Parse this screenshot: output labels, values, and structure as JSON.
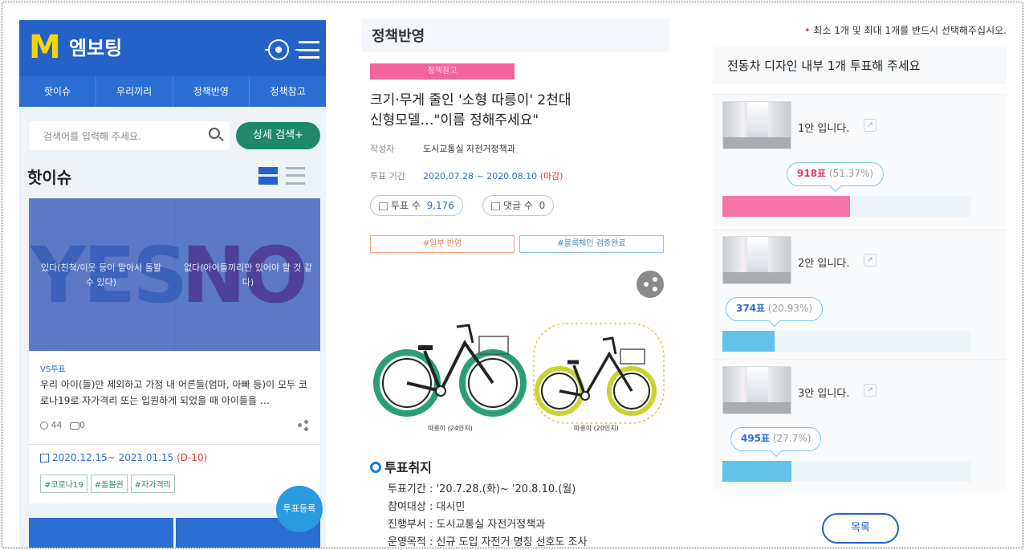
{
  "app": {
    "logo_letter": "M",
    "logo_text": "엠보팅"
  },
  "nav": {
    "tabs": [
      "핫이슈",
      "우리끼리",
      "정책반영",
      "정책참고"
    ]
  },
  "search": {
    "placeholder": "검색어를 입력해 주세요.",
    "detail_button": "상세 검색+"
  },
  "hot_issue": {
    "title": "핫이슈",
    "card": {
      "yes_word": "YES",
      "no_word": "NO",
      "yes_text": "있다(친척/이웃 등이 맡아서 돌봘 수 있다)",
      "no_text": "없다(아이들끼리만 있어야 할 것 같다)",
      "type": "VS투표",
      "desc": "우리 아이(들)만 제외하고 가정 내 어른들(엄마, 아빠 등)이 모두 코로나19로 자가격리 또는 입원하게 되었을 때 아이들을 …",
      "participants": "44",
      "comments": "0",
      "date": "2020.12.15~ 2021.01.15",
      "dday": "(D-10)",
      "tags": [
        "#코로나19",
        "#돌봄권",
        "#자가격리"
      ]
    },
    "fab": "투표등록"
  },
  "policy": {
    "header": "정책반영",
    "badge": "정책참고",
    "headline_line1": "크기·무게 줄인 '소형 따릉이' 2천대",
    "headline_line2": "신형모델…\"이름 정해주세요\"",
    "author_label": "작성자",
    "author": "도시교통실 자전거정책과",
    "period_label": "투표 기간",
    "period": "2020.07.28 ~ 2020.08.10",
    "period_status": "(마감)",
    "votes_label": "투표 수",
    "votes": "9,176",
    "comments_label": "댓글 수",
    "comments": "0",
    "status_partial": "#일부 반영",
    "status_blockchain": "#블록체인 검증완료",
    "bike_caption_left": "따릉이 (24인치)",
    "bike_caption_right": "따릉이 (20인치)",
    "section_title": "투표취지",
    "info": [
      "투표기간 : '20.7.28.(화)~ '20.8.10.(월)",
      "참여대상 : 대시민",
      "진행부서 : 도시교통실 자전거정책과",
      "운영목적 : 신규 도입 자전거 명칭 선호도 조사"
    ]
  },
  "vote": {
    "note": "최소 1개 및 최대 1개를 반드시 선택해주십시오.",
    "question": "전동차 디자인 내부 1개 투표해 주세요",
    "options": [
      {
        "label": "1안 입니다.",
        "votes": "918표",
        "pct": "(51.37%)",
        "share": 51.37,
        "color": "#f774a8",
        "vote_color": "#e23a6f"
      },
      {
        "label": "2안 입니다.",
        "votes": "374표",
        "pct": "(20.93%)",
        "share": 20.93,
        "color": "#62c3ea",
        "vote_color": "#2b6dd3"
      },
      {
        "label": "3안 입니다.",
        "votes": "495표",
        "pct": "(27.7%)",
        "share": 27.7,
        "color": "#62c3ea",
        "vote_color": "#2b6dd3"
      }
    ],
    "list_button": "목록"
  }
}
